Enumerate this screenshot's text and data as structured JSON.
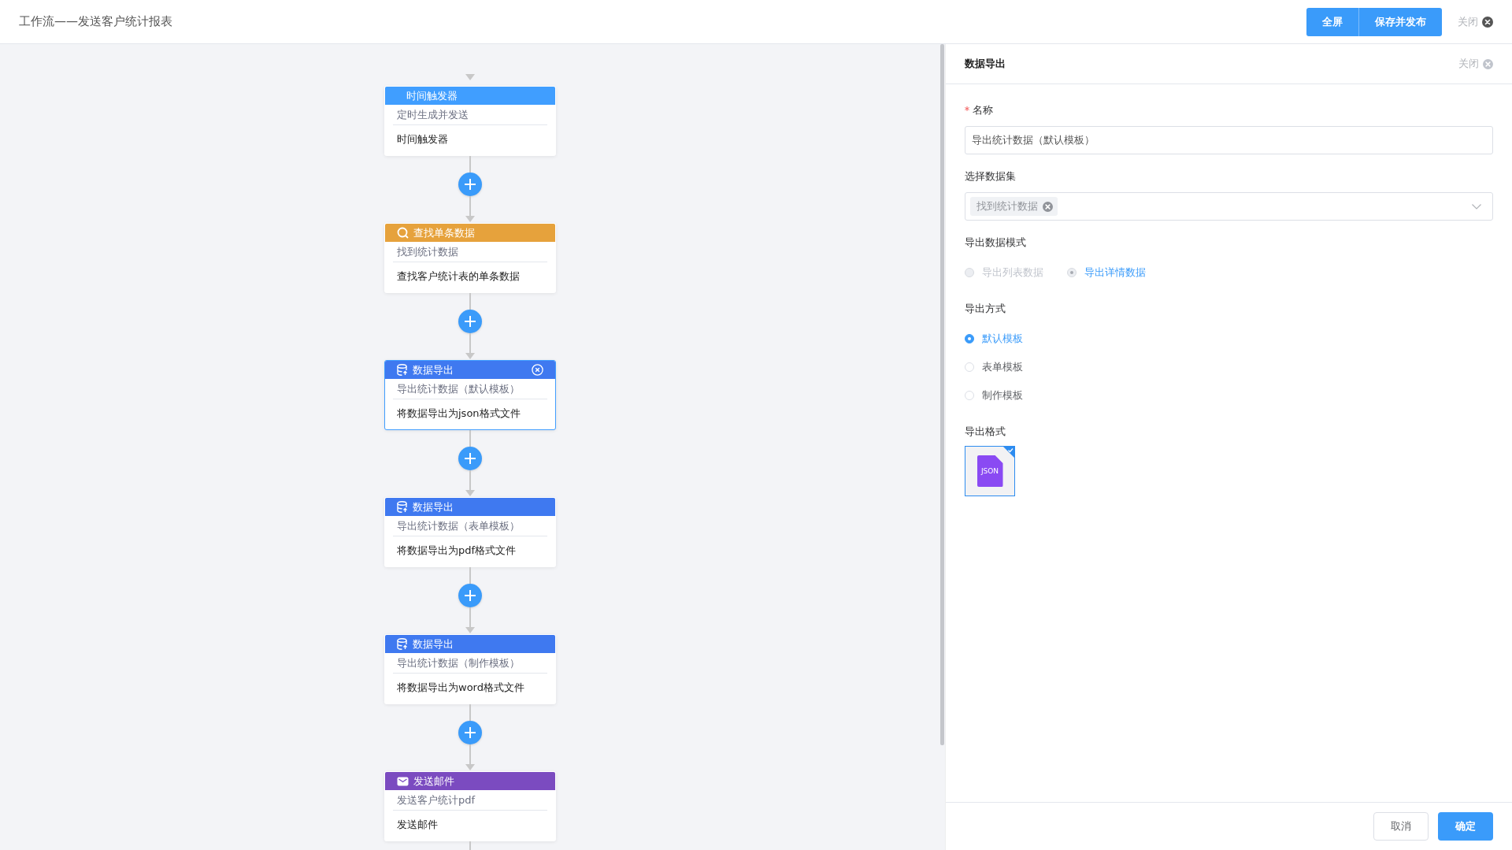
{
  "window": {
    "title": "工作流——发送客户统计报表"
  },
  "toolbar": {
    "buttons": [
      "全屏",
      "保存并发布"
    ],
    "close": "关闭"
  },
  "flow": {
    "nodes": [
      {
        "kind": "timer",
        "title": "时间触发器",
        "subtitle": "定时生成并发送",
        "description": "时间触发器",
        "selected": false
      },
      {
        "kind": "search",
        "title": "查找单条数据",
        "subtitle": "找到统计数据",
        "description": "查找客户统计表的单条数据",
        "selected": false
      },
      {
        "kind": "export",
        "title": "数据导出",
        "subtitle": "导出统计数据（默认模板）",
        "description": "将数据导出为json格式文件",
        "selected": true
      },
      {
        "kind": "export",
        "title": "数据导出",
        "subtitle": "导出统计数据（表单模板）",
        "description": "将数据导出为pdf格式文件",
        "selected": false
      },
      {
        "kind": "export",
        "title": "数据导出",
        "subtitle": "导出统计数据（制作模板）",
        "description": "将数据导出为word格式文件",
        "selected": false
      },
      {
        "kind": "email",
        "title": "发送邮件",
        "subtitle": "发送客户统计pdf",
        "description": "发送邮件",
        "selected": false
      }
    ]
  },
  "panel": {
    "title": "数据导出",
    "close": "关闭",
    "name_field": {
      "label": "名称",
      "required": true,
      "value": "导出统计数据（默认模板）"
    },
    "dataset_field": {
      "label": "选择数据集",
      "tags": [
        "找到统计数据"
      ]
    },
    "mode": {
      "label": "导出数据模式",
      "options": [
        {
          "label": "导出列表数据",
          "selected": false,
          "disabled": true
        },
        {
          "label": "导出详情数据",
          "selected": true,
          "disabled": true
        }
      ]
    },
    "method": {
      "label": "导出方式",
      "options": [
        {
          "label": "默认模板",
          "selected": true
        },
        {
          "label": "表单模板",
          "selected": false
        },
        {
          "label": "制作模板",
          "selected": false
        }
      ]
    },
    "format": {
      "label": "导出格式",
      "options": [
        {
          "label": "JSON",
          "selected": true
        }
      ]
    },
    "footer": {
      "cancel": "取消",
      "confirm": "确定"
    }
  }
}
